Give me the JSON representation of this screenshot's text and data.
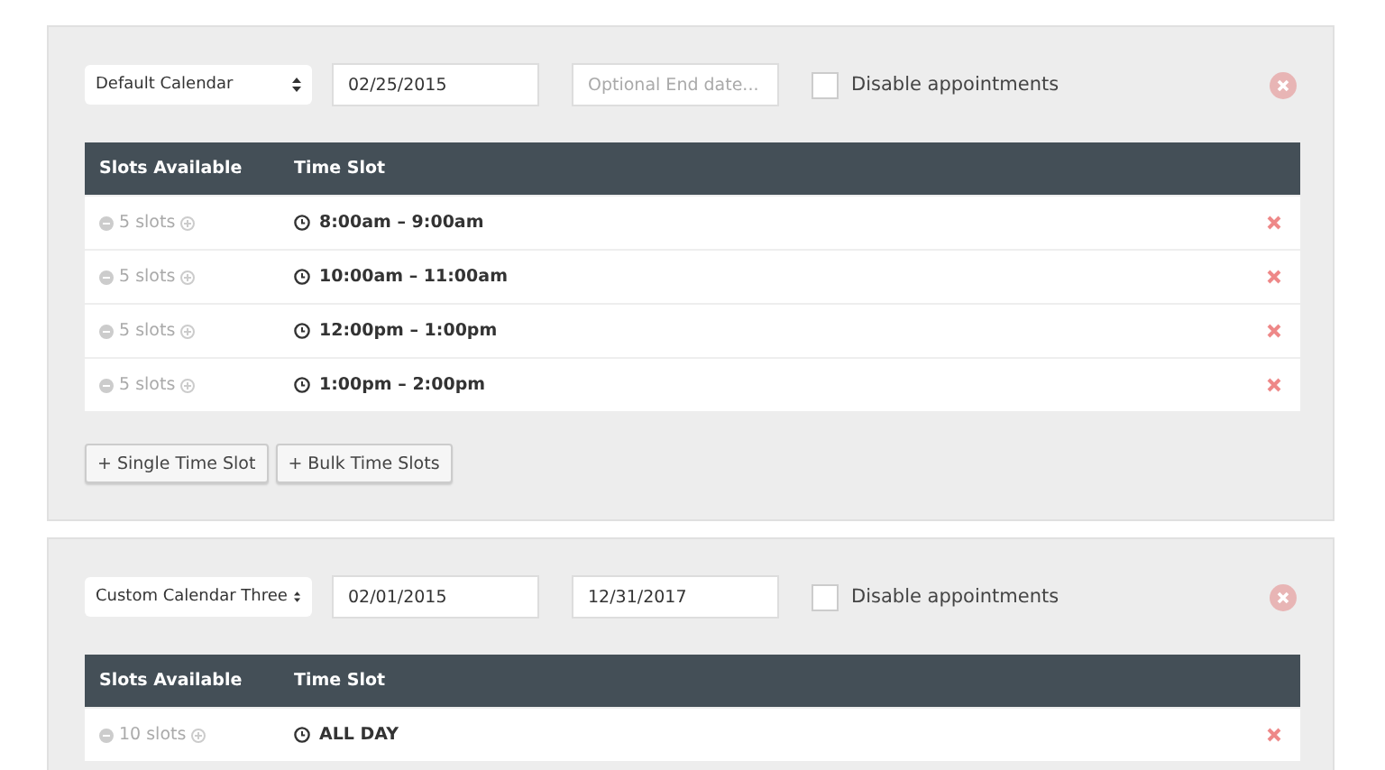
{
  "calendars": [
    {
      "calendar": "Default Calendar",
      "start_date": "02/25/2015",
      "end_placeholder": "Optional End date...",
      "disable_label": "Disable appointments",
      "disabled": false,
      "columns": [
        "Slots Available",
        "Time Slot"
      ],
      "rows": [
        {
          "slots": "5 slots",
          "time": "8:00am – 9:00am"
        },
        {
          "slots": "5 slots",
          "time": "10:00am – 11:00am"
        },
        {
          "slots": "5 slots",
          "time": "12:00pm – 1:00pm"
        },
        {
          "slots": "5 slots",
          "time": "1:00pm – 2:00pm"
        }
      ],
      "buttons": [
        "+ Single Time Slot",
        "+ Bulk Time Slots"
      ]
    },
    {
      "calendar": "Custom Calendar Three",
      "start_date": "02/01/2015",
      "end_date": "12/31/2017",
      "disable_label": "Disable appointments",
      "disabled": false,
      "columns": [
        "Slots Available",
        "Time Slot"
      ],
      "rows": [
        {
          "slots": "10 slots",
          "time": "ALL DAY"
        }
      ]
    }
  ]
}
